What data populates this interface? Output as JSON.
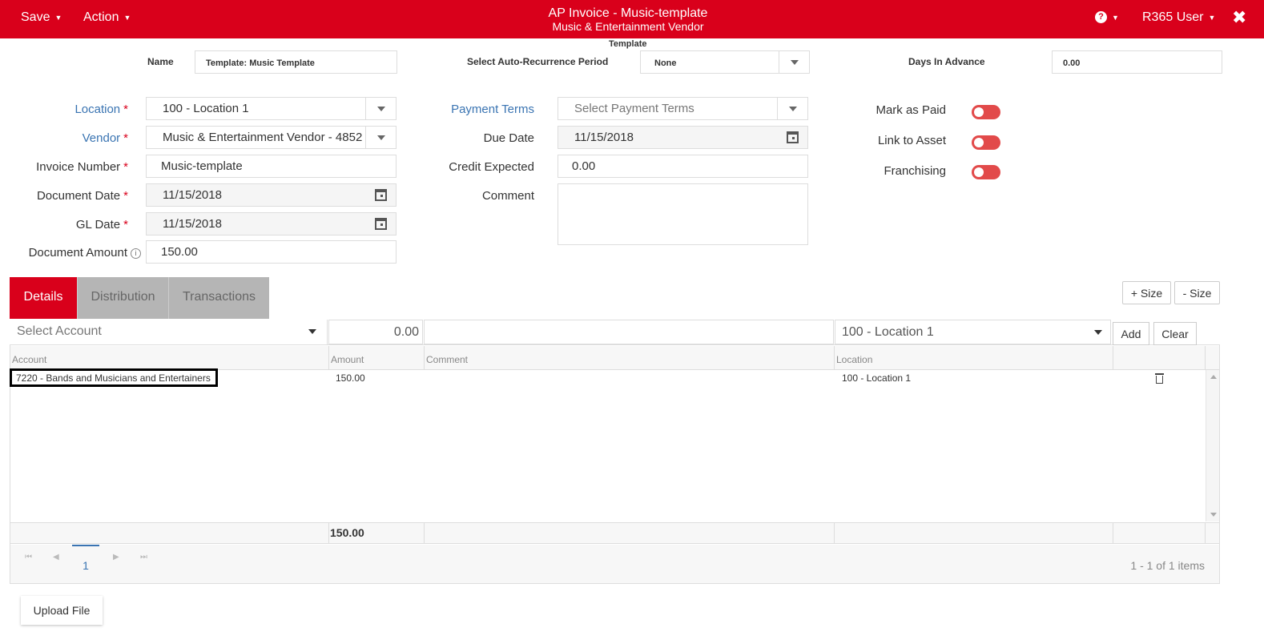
{
  "topbar": {
    "save_label": "Save",
    "action_label": "Action",
    "title": "AP Invoice - Music-template",
    "subtitle": "Music & Entertainment Vendor",
    "help_label": "?",
    "user_label": "R365 User",
    "close_label": "✖"
  },
  "template": {
    "section_label": "Template",
    "name_label": "Name",
    "name_value": "Template: Music Template",
    "recurrence_label": "Select Auto-Recurrence Period",
    "recurrence_value": "None",
    "days_label": "Days In Advance",
    "days_value": "0.00"
  },
  "form": {
    "location_label": "Location",
    "location_value": "100 - Location 1",
    "vendor_label": "Vendor",
    "vendor_value": "Music & Entertainment Vendor - 4852",
    "invoice_number_label": "Invoice Number",
    "invoice_number_value": "Music-template",
    "document_date_label": "Document Date",
    "document_date_value": "11/15/2018",
    "gl_date_label": "GL Date",
    "gl_date_value": "11/15/2018",
    "document_amount_label": "Document Amount",
    "document_amount_value": "150.00",
    "payment_terms_label": "Payment Terms",
    "payment_terms_placeholder": "Select Payment Terms",
    "due_date_label": "Due Date",
    "due_date_value": "11/15/2018",
    "credit_expected_label": "Credit Expected",
    "credit_expected_value": "0.00",
    "comment_label": "Comment",
    "mark_paid_label": "Mark as Paid",
    "link_asset_label": "Link to Asset",
    "franchising_label": "Franchising",
    "required_mark": "*",
    "info_glyph": "i"
  },
  "tabs": [
    "Details",
    "Distribution",
    "Transactions"
  ],
  "size_buttons": {
    "plus": "+ Size",
    "minus": "- Size"
  },
  "entry": {
    "account_placeholder": "Select Account",
    "amount_value": "0.00",
    "location_value": "100 - Location 1",
    "add_label": "Add",
    "clear_label": "Clear"
  },
  "grid": {
    "headers": [
      "Account",
      "Amount",
      "Comment",
      "Location"
    ],
    "rows": [
      {
        "account": "7220 - Bands and Musicians and Entertainers",
        "amount": "150.00",
        "comment": "",
        "location": "100 - Location 1"
      }
    ],
    "total_amount": "150.00"
  },
  "pager": {
    "first": "⏮",
    "prev": "◀",
    "current_page": "1",
    "next": "▶",
    "last": "⏭",
    "info": "1 - 1 of 1 items"
  },
  "upload_label": "Upload File",
  "colors": {
    "brand": "#d9001b",
    "link": "#3a74b2",
    "toggle_off": "#e24a4a"
  },
  "icons": [
    "help-icon",
    "close-icon",
    "chevron-down-icon",
    "calendar-icon",
    "info-icon",
    "trash-icon",
    "toggle-switch"
  ]
}
